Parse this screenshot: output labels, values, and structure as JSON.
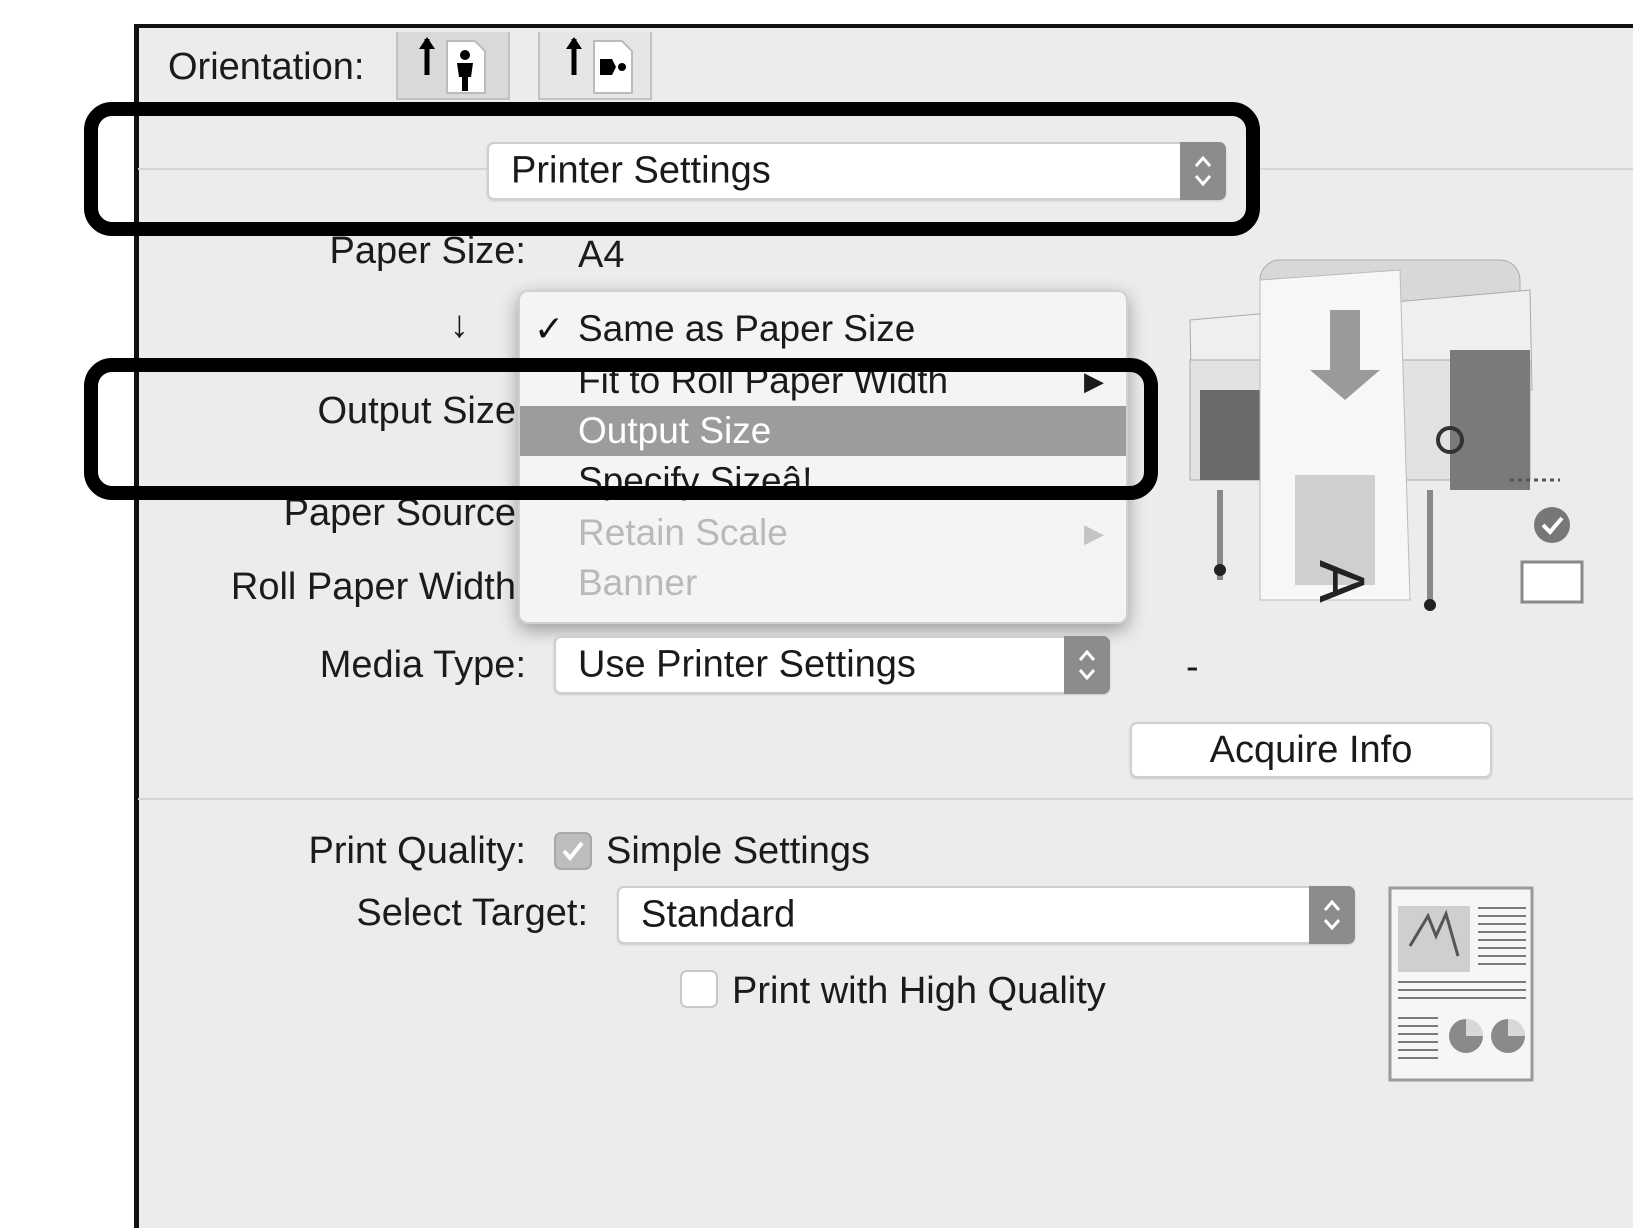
{
  "orientation": {
    "label": "Orientation:",
    "options": [
      {
        "name": "portrait",
        "selected": true
      },
      {
        "name": "landscape",
        "selected": false
      }
    ]
  },
  "section_popup": {
    "value": "Printer Settings"
  },
  "paper_size": {
    "label": "Paper Size:",
    "value": "A4"
  },
  "arrow_glyph": "↓",
  "output_size_label": "Output Size",
  "paper_source_label": "Paper Source",
  "roll_paper_width_label": "Roll Paper Width",
  "size_menu": {
    "items": [
      {
        "label": "Same as Paper Size",
        "checked": true,
        "enabled": true
      },
      {
        "label": "Fit to Roll Paper Width",
        "enabled": true,
        "submenu": true
      },
      {
        "label": "Output Size",
        "enabled": true,
        "highlighted": true
      },
      {
        "label": "Specify Sizeâ!",
        "enabled": true
      },
      {
        "label": "Retain Scale",
        "enabled": false,
        "submenu": true
      },
      {
        "label": "Banner",
        "enabled": false
      }
    ],
    "check_glyph": "✓",
    "submenu_glyph": "▶"
  },
  "media_type": {
    "label": "Media Type:",
    "value": "Use Printer Settings",
    "extra": "-"
  },
  "acquire_info_button": "Acquire Info",
  "print_quality": {
    "label": "Print Quality:",
    "simple_settings_label": "Simple Settings",
    "simple_settings_checked": true
  },
  "select_target": {
    "label": "Select Target:",
    "value": "Standard"
  },
  "high_quality": {
    "label": "Print with High Quality",
    "checked": false
  },
  "colors": {
    "panel": "#ececec",
    "selected_menu": "#9c9c9c",
    "highlight_border": "#000000"
  }
}
